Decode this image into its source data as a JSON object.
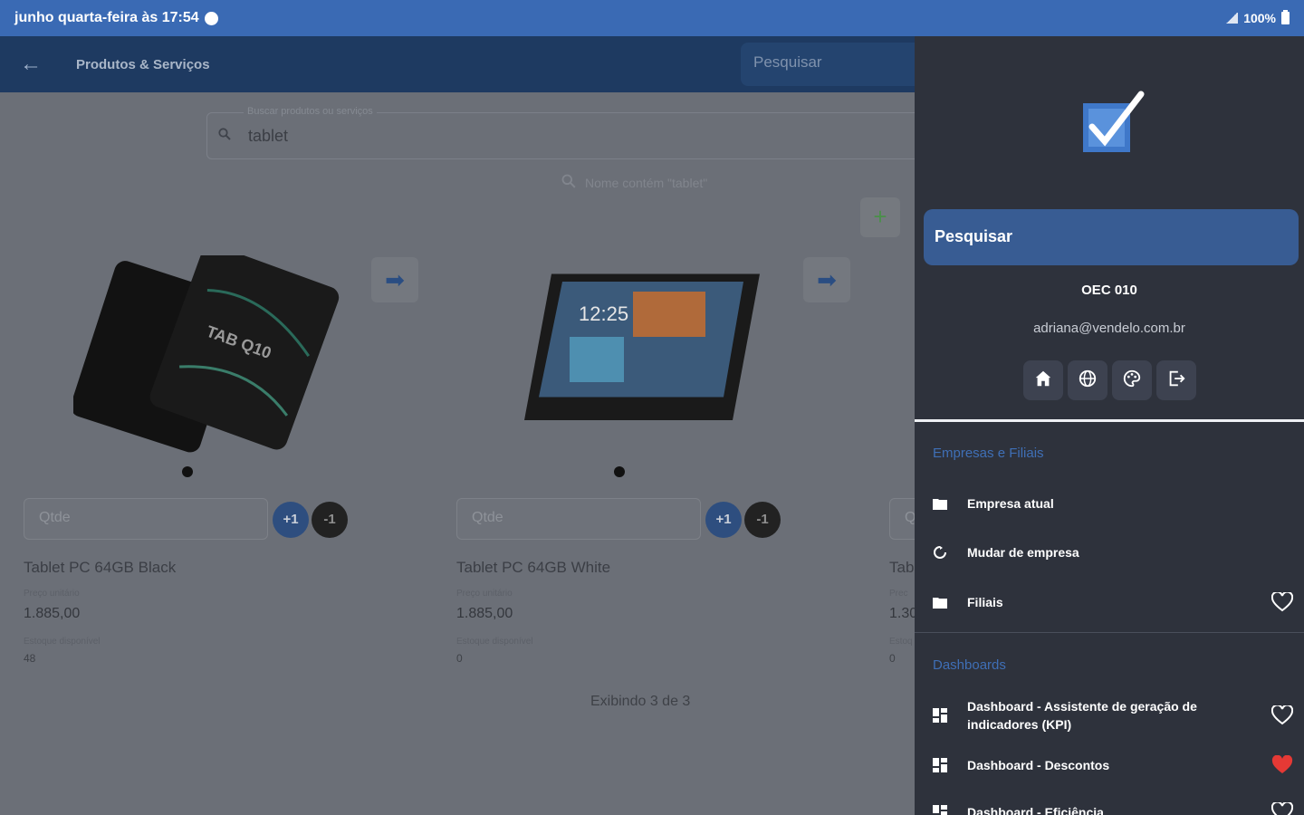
{
  "status_bar": {
    "datetime": "junho quarta-feira às 17:54",
    "battery": "100%"
  },
  "app_bar": {
    "title": "Produtos & Serviços",
    "search_placeholder": "Pesquisar"
  },
  "search": {
    "legend": "Buscar produtos ou serviços",
    "value": "tablet",
    "filter_text": "Nome contém \"tablet\""
  },
  "products": [
    {
      "name": "Tablet PC 64GB Black",
      "price_label": "Preço unitário",
      "price": "1.885,00",
      "stock_label": "Estoque disponível",
      "stock": "48",
      "qty_placeholder": "Qtde",
      "plus_label": "+1",
      "minus_label": "-1",
      "image_text": "TAB Q10"
    },
    {
      "name": "Tablet PC 64GB White",
      "price_label": "Preço unitário",
      "price": "1.885,00",
      "stock_label": "Estoque disponível",
      "stock": "0",
      "qty_placeholder": "Qtde",
      "plus_label": "+1",
      "minus_label": "-1",
      "image_text": "12:25"
    },
    {
      "name": "Tab",
      "price_label": "Prec",
      "price": "1.30",
      "stock_label": "Estoq",
      "stock": "0",
      "qty_placeholder": "Q"
    }
  ],
  "footer": {
    "count_text": "Exibindo 3 de 3"
  },
  "drawer": {
    "search_label": "Pesquisar",
    "company": "OEC 010",
    "email": "adriana@vendelo.com.br",
    "sections": [
      {
        "title": "Empresas e Filiais",
        "items": [
          {
            "label": "Empresa atual",
            "icon": "folder-icon",
            "favorite": null
          },
          {
            "label": "Mudar de empresa",
            "icon": "refresh-icon",
            "favorite": null
          },
          {
            "label": "Filiais",
            "icon": "folder-icon",
            "favorite": false
          }
        ]
      },
      {
        "title": "Dashboards",
        "items": [
          {
            "label": "Dashboard - Assistente de geração de indicadores (KPI)",
            "icon": "dashboard-icon",
            "favorite": false
          },
          {
            "label": "Dashboard - Descontos",
            "icon": "dashboard-icon",
            "favorite": true
          },
          {
            "label": "Dashboard - Eficiência",
            "icon": "dashboard-icon",
            "favorite": false
          }
        ]
      }
    ]
  },
  "colors": {
    "status_bar": "#3a6ab4",
    "app_bar": "#1e3a61",
    "drawer_bg": "#2e323c",
    "accent_blue": "#385c93",
    "section_title": "#3f6fb6",
    "heart_active": "#e53935"
  }
}
